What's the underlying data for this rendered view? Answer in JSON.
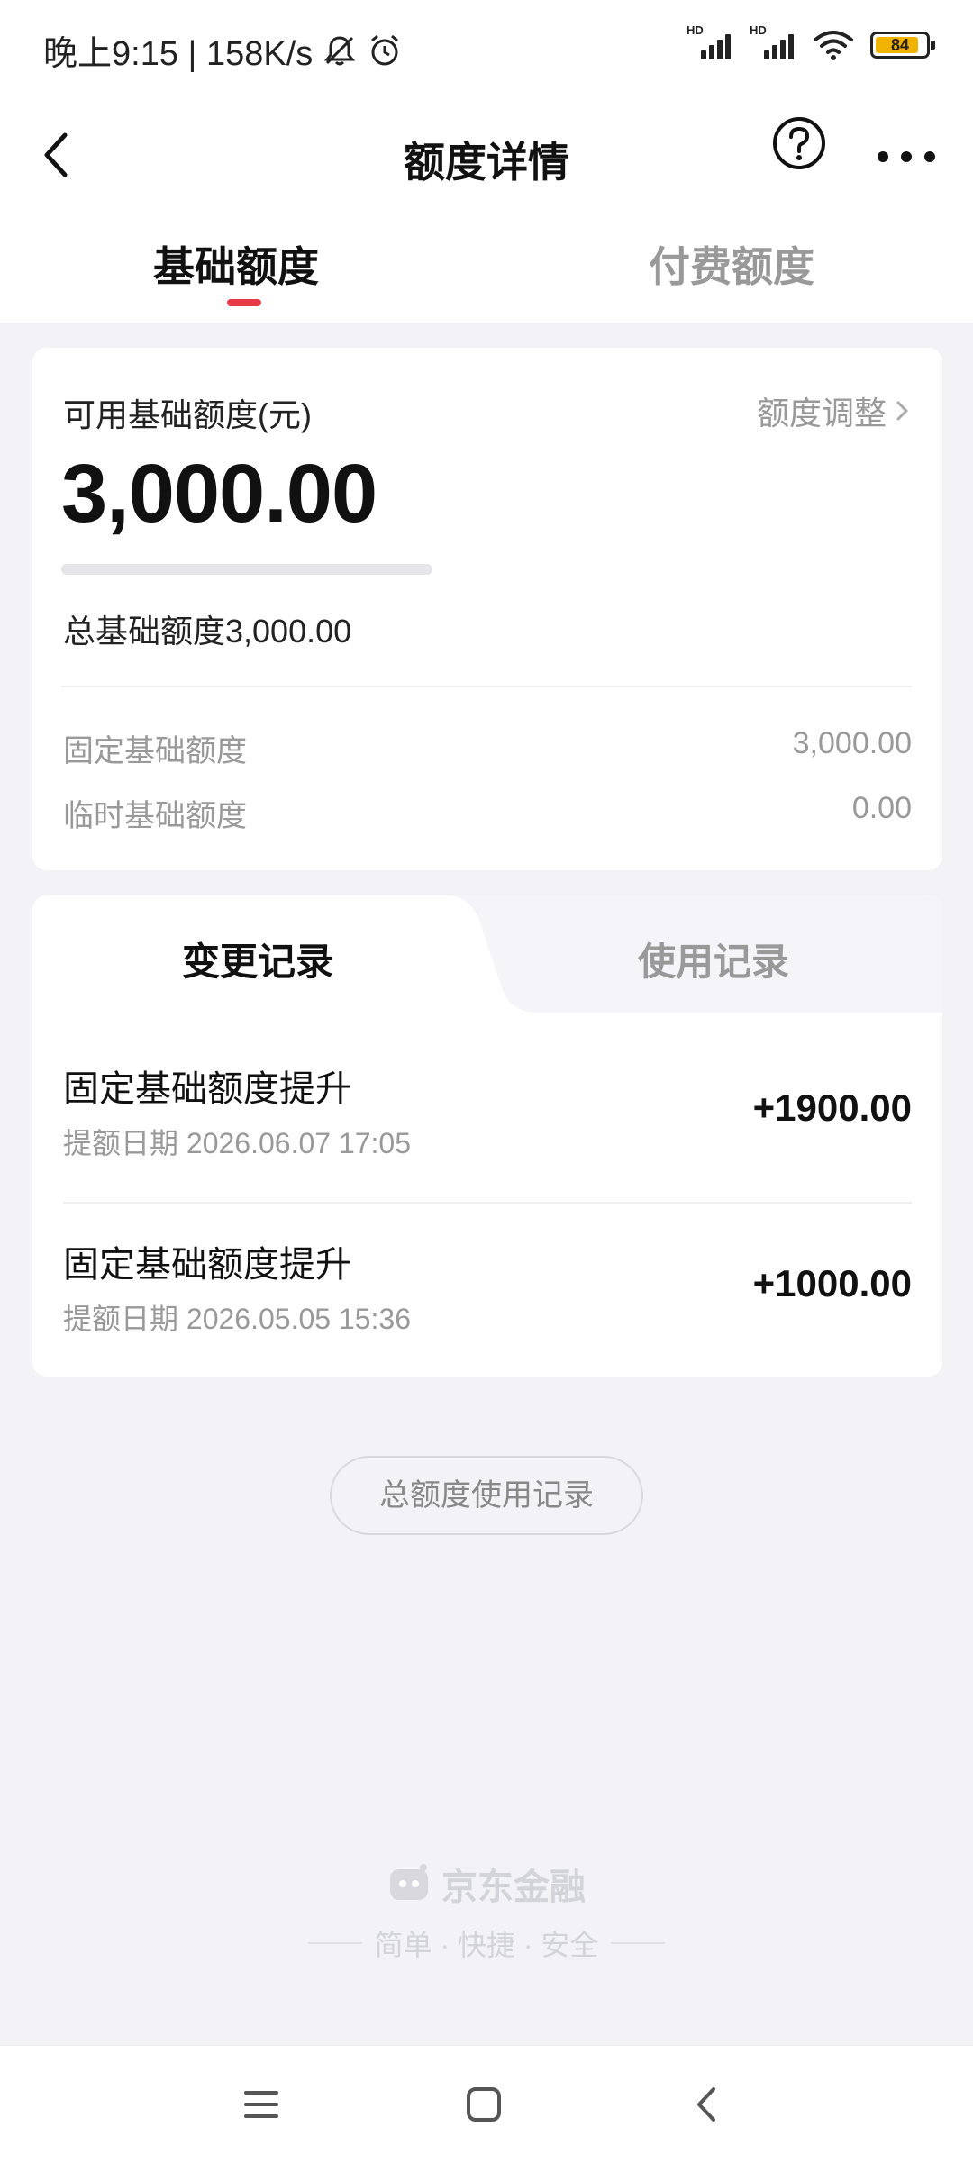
{
  "status_bar": {
    "time_speed": "晚上9:15 | 158K/s",
    "signal1_label": "HD",
    "signal2_label": "HD",
    "battery_level": "84"
  },
  "header": {
    "title": "额度详情"
  },
  "tabs": [
    {
      "label": "基础额度",
      "active": true
    },
    {
      "label": "付费额度",
      "active": false
    }
  ],
  "credit": {
    "available_label": "可用基础额度(元)",
    "adjust_label": "额度调整",
    "available_amount": "3,000.00",
    "usage_fraction": 0,
    "total_text": "总基础额度3,000.00",
    "fixed_label": "固定基础额度",
    "fixed_value": "3,000.00",
    "temp_label": "临时基础额度",
    "temp_value": "0.00"
  },
  "records": {
    "tabs": [
      {
        "label": "变更记录",
        "active": true
      },
      {
        "label": "使用记录",
        "active": false
      }
    ],
    "items": [
      {
        "title": "固定基础额度提升",
        "date": "提额日期 2026.06.07 17:05",
        "amount": "+1900.00"
      },
      {
        "title": "固定基础额度提升",
        "date": "提额日期 2026.05.05 15:36",
        "amount": "+1000.00"
      }
    ]
  },
  "total_usage_button": "总额度使用记录",
  "brand": {
    "name": "京东金融",
    "slogan": "简单 · 快捷 · 安全"
  },
  "colors": {
    "accent": "#e8394a",
    "background": "#f2f2f7"
  }
}
